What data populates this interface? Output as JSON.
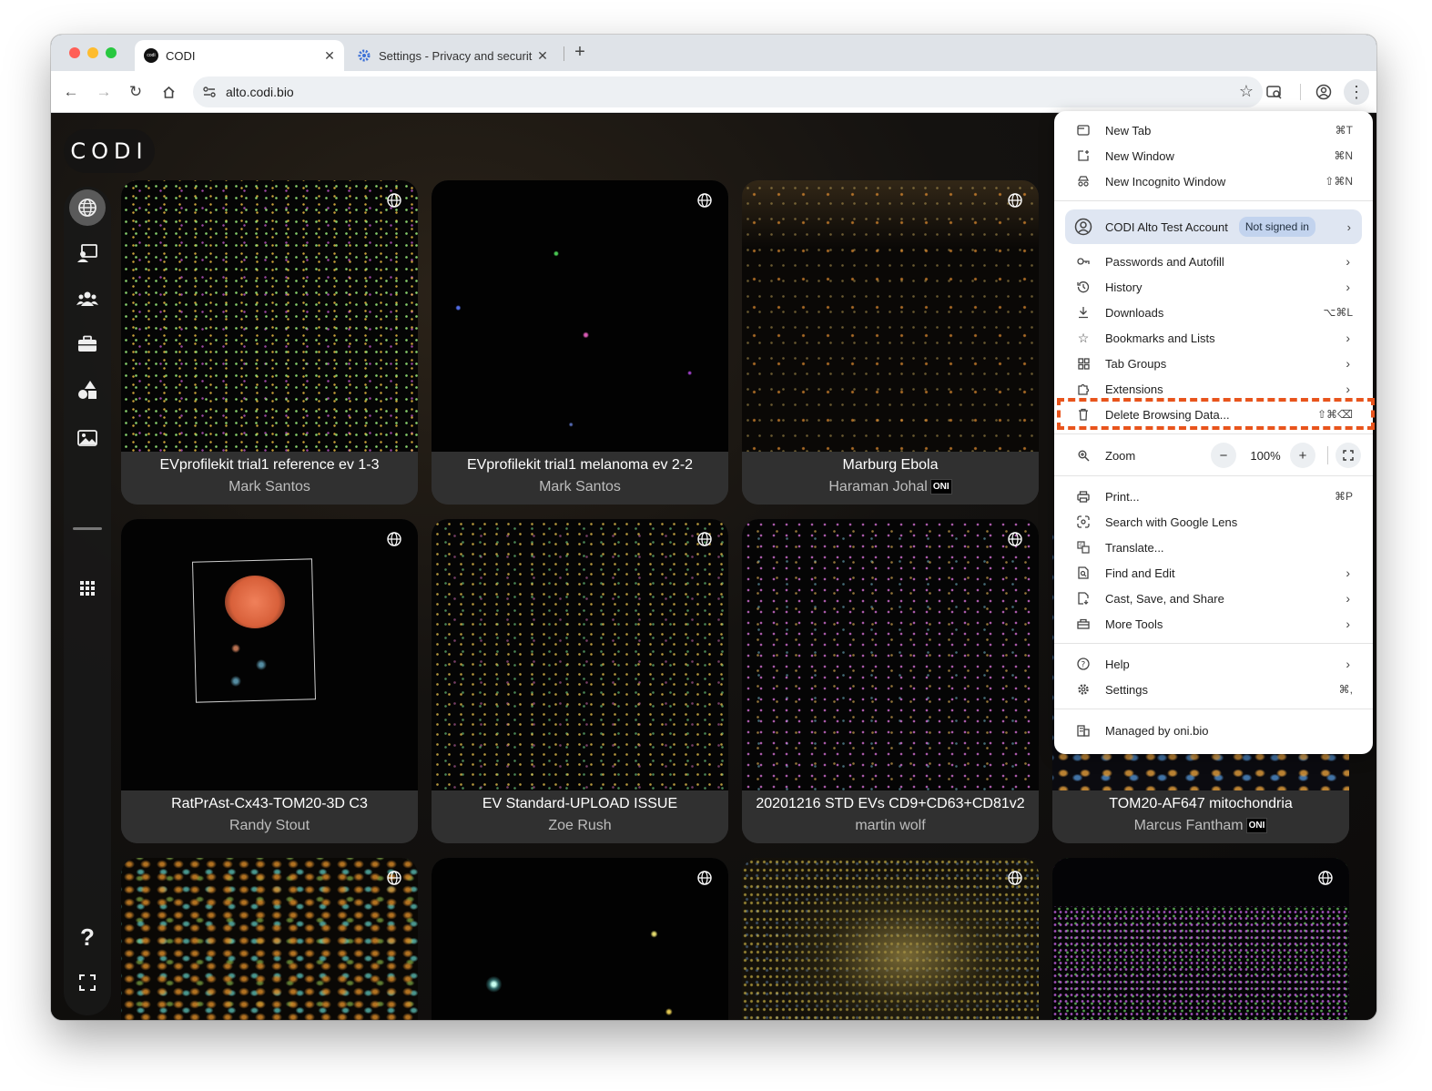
{
  "browser": {
    "tabs": [
      {
        "title": "CODI",
        "active": true
      },
      {
        "title": "Settings - Privacy and securit",
        "active": false
      }
    ],
    "new_tab_symbol": "+",
    "url": "alto.codi.bio"
  },
  "app": {
    "logo": "CODI",
    "sidebar": [
      "globe-icon",
      "screen-user-icon",
      "group-icon",
      "briefcase-icon",
      "shapes-icon",
      "image-icon",
      "grid-icon",
      "help-icon",
      "fullscreen-icon"
    ]
  },
  "cards": [
    {
      "title": "EVprofilekit trial1 reference ev 1-3",
      "author": "Mark Santos",
      "oni": false
    },
    {
      "title": "EVprofilekit trial1 melanoma ev 2-2",
      "author": "Mark Santos",
      "oni": false
    },
    {
      "title": "Marburg Ebola",
      "author": "Haraman Johal",
      "oni": true
    },
    {
      "title": "RatPrAst-Cx43-TOM20-3D C3",
      "author": "Randy Stout",
      "oni": false
    },
    {
      "title": "EV Standard-UPLOAD ISSUE",
      "author": "Zoe Rush",
      "oni": false
    },
    {
      "title": "20201216 STD EVs CD9+CD63+CD81v2",
      "author": "martin wolf",
      "oni": false
    },
    {
      "title": "TOM20-AF647 mitochondria",
      "author": "Marcus Fantham",
      "oni": true
    }
  ],
  "oni_label": "ONI",
  "menu": {
    "new_tab": {
      "label": "New Tab",
      "shortcut": "⌘T"
    },
    "new_window": {
      "label": "New Window",
      "shortcut": "⌘N"
    },
    "new_incognito": {
      "label": "New Incognito Window",
      "shortcut": "⇧⌘N"
    },
    "account": {
      "name": "CODI Alto Test Account",
      "status": "Not signed in"
    },
    "passwords": {
      "label": "Passwords and Autofill"
    },
    "history": {
      "label": "History"
    },
    "downloads": {
      "label": "Downloads",
      "shortcut": "⌥⌘L"
    },
    "bookmarks": {
      "label": "Bookmarks and Lists"
    },
    "tab_groups": {
      "label": "Tab Groups"
    },
    "extensions": {
      "label": "Extensions"
    },
    "delete_data": {
      "label": "Delete Browsing Data...",
      "shortcut": "⇧⌘⌫"
    },
    "zoom": {
      "label": "Zoom",
      "value": "100%",
      "minus": "−",
      "plus": "+"
    },
    "print": {
      "label": "Print...",
      "shortcut": "⌘P"
    },
    "lens": {
      "label": "Search with Google Lens"
    },
    "translate": {
      "label": "Translate..."
    },
    "find_edit": {
      "label": "Find and Edit"
    },
    "cast": {
      "label": "Cast, Save, and Share"
    },
    "more_tools": {
      "label": "More Tools"
    },
    "help": {
      "label": "Help"
    },
    "settings": {
      "label": "Settings",
      "shortcut": "⌘,"
    },
    "managed": {
      "label": "Managed by oni.bio"
    }
  },
  "colors": {
    "highlight": "#e8541c",
    "account_bg": "#dfe6f2"
  }
}
